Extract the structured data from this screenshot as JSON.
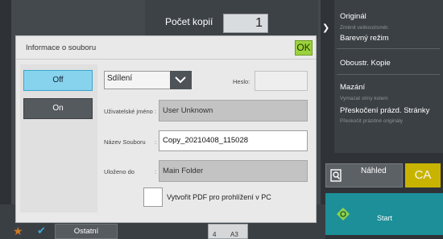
{
  "background": {
    "copies_label": "Počet kopií",
    "copies_value": "1"
  },
  "right_menu": {
    "items": [
      {
        "label": "Originál",
        "sub": "Změnit velikost/směr."
      },
      {
        "label": "Barevný režim",
        "sub": ""
      },
      {
        "label": "Oboustr. Kopie",
        "sub": ""
      },
      {
        "label": "Mazání",
        "sub": "Vymazat stíny kolem"
      },
      {
        "label": "Přeskočení prázd. Stránky",
        "sub": "Přeskočit prázdné originály"
      }
    ],
    "preview_label": "Náhled",
    "ca_label": "CA",
    "start_label": "Start"
  },
  "bottom_bar": {
    "ostatni_label": "Ostatní",
    "paper_num": "4",
    "paper_size": "A3"
  },
  "dialog": {
    "title": "Informace o souboru",
    "ok_label": "OK",
    "off_label": "Off",
    "on_label": "On",
    "share_value": "Sdílení",
    "password_label": "Heslo:",
    "user_label": "Uživatelské jméno",
    "user_value": "User Unknown",
    "file_label": "Název Souboru",
    "file_value": "Copy_20210408_115028",
    "saved_label": "Uloženo do",
    "saved_value": "Main Folder",
    "pdf_label": "Vytvořit PDF pro prohlížení v PC"
  },
  "colors": {
    "off_selected": "#87d3ee",
    "ok_button": "#9bd23c",
    "start_button": "#1c8f98",
    "ca_button": "#c8b400"
  }
}
